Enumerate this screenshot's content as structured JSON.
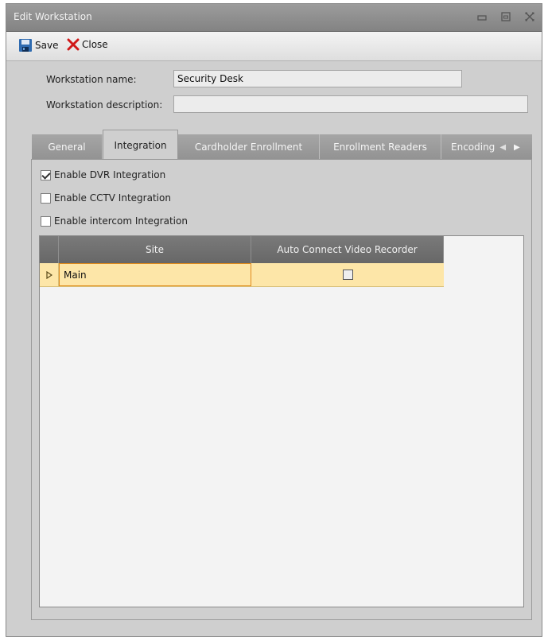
{
  "window": {
    "title": "Edit Workstation"
  },
  "toolbar": {
    "save_label": "Save",
    "close_label": "Close"
  },
  "form": {
    "name_label": "Workstation name:",
    "name_value": "Security Desk",
    "description_label": "Workstation description:",
    "description_value": ""
  },
  "tabs": [
    {
      "label": "General",
      "active": false
    },
    {
      "label": "Integration",
      "active": true
    },
    {
      "label": "Cardholder Enrollment",
      "active": false
    },
    {
      "label": "Enrollment Readers",
      "active": false
    },
    {
      "label": "Encoding",
      "active": false
    }
  ],
  "integration": {
    "options": [
      {
        "label": "Enable DVR Integration",
        "checked": true
      },
      {
        "label": "Enable CCTV Integration",
        "checked": false
      },
      {
        "label": "Enable intercom Integration",
        "checked": false
      }
    ],
    "grid": {
      "columns": [
        "Site",
        "Auto Connect Video Recorder"
      ],
      "rows": [
        {
          "site": "Main",
          "auto_connect": false
        }
      ]
    }
  },
  "colors": {
    "selected_row": "#fde6a8",
    "focus_border": "#e08a1a",
    "close_x": "#d01818",
    "save_icon": "#2f6bb0"
  }
}
